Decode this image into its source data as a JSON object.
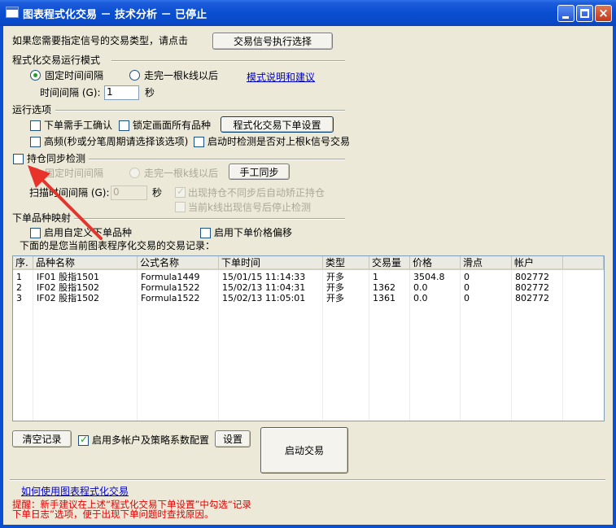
{
  "window": {
    "title": "图表程式化交易 － 技术分析 － 已停止",
    "controls": [
      "minimize-icon",
      "maximize-icon",
      "close-icon"
    ],
    "close_glyph": "×"
  },
  "signal_select": {
    "prompt": "如果您需要指定信号的交易类型，请点击",
    "button": "交易信号执行选择"
  },
  "run_mode": {
    "section": "程式化交易运行模式",
    "option_fixed": "固定时间间隔",
    "option_kline": "走完一根k线以后",
    "link": "模式说明和建议",
    "interval_label": "时间间隔 (G):",
    "interval_value": "1",
    "interval_unit": "秒",
    "selected": "fixed"
  },
  "run_options": {
    "section": "运行选项",
    "manual_confirm": "下单需手工确认",
    "lock_all": "锁定画面所有品种",
    "order_settings_button": "程式化交易下单设置",
    "high_freq": "高频(秒或分笔周期请选择该选项)",
    "check_signal": "启动时检测是否对上根k信号交易"
  },
  "sync": {
    "section": "持仓同步检测",
    "option_fixed": "固定时间间隔",
    "option_kline": "走完一根k线以后",
    "manual_sync_button": "手工同步",
    "scan_label": "扫描时间间隔 (G):",
    "scan_value": "0",
    "scan_unit": "秒",
    "auto_fix": "出现持仓不同步后自动矫正持仓",
    "stop_on_signal": "当前k线出现信号后停止检测"
  },
  "mapping": {
    "section": "下单品种映射",
    "custom_symbol": "启用自定义下单品种",
    "price_offset": "启用下单价格偏移"
  },
  "records": {
    "caption": "下面的是您当前图表程序化交易的交易记录：",
    "columns": [
      "序.",
      "品种名称",
      "公式名称",
      "下单时间",
      "类型",
      "交易量",
      "价格",
      "滑点",
      "帐户"
    ],
    "rows": [
      [
        "1",
        "IF01 股指1501",
        "Formula1449",
        "15/01/15 11:14:33",
        "开多",
        "1",
        "3504.8",
        "0",
        "802772"
      ],
      [
        "2",
        "IF02 股指1502",
        "Formula1522",
        "15/02/13 11:04:31",
        "开多",
        "1362",
        "0.0",
        "0",
        "802772"
      ],
      [
        "3",
        "IF02 股指1502",
        "Formula1522",
        "15/02/13 11:05:01",
        "开多",
        "1361",
        "0.0",
        "0",
        "802772"
      ]
    ]
  },
  "bottom": {
    "clear_button": "清空记录",
    "multi_account": "启用多帐户及策略系数配置",
    "settings_button": "设置",
    "start_button": "启动交易",
    "help_link": "如何使用图表程式化交易",
    "tip_line1": "提醒：新手建议在上述“程式化交易下单设置”中勾选“记录",
    "tip_line2": "下单日志”选项，便于出现下单问题时查找原因。"
  },
  "overlay": {
    "arrow_color": "#E8322A"
  }
}
